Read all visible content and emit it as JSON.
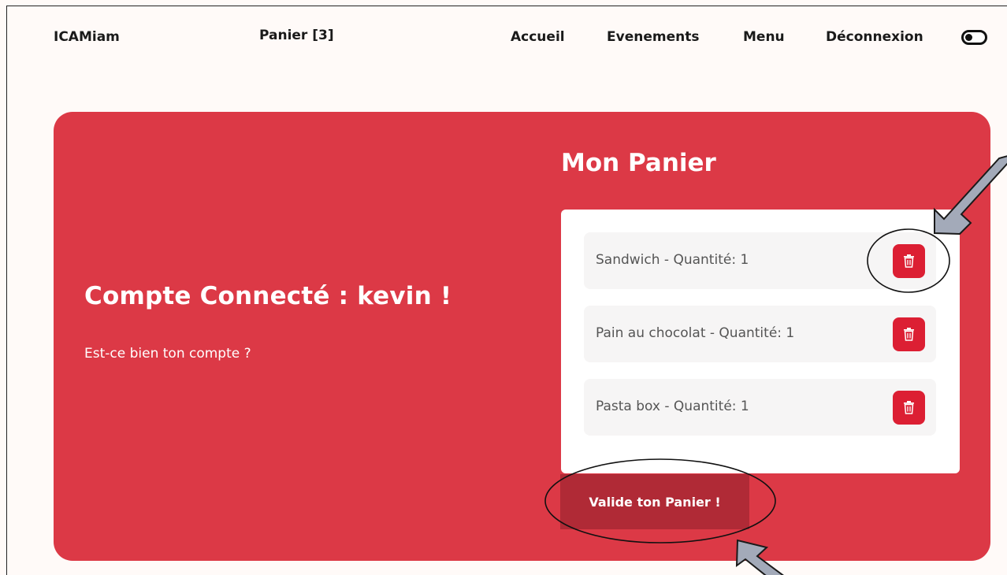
{
  "header": {
    "brand": "ICAMiam",
    "cart_label": "Panier [3]",
    "nav": {
      "accueil": "Accueil",
      "evenements": "Evenements",
      "menu": "Menu",
      "deconnexion": "Déconnexion"
    }
  },
  "account": {
    "title": "Compte Connecté : kevin !",
    "question": "Est-ce bien ton compte ?"
  },
  "cart": {
    "title": "Mon Panier",
    "items": [
      {
        "label": "Sandwich - Quantité: 1"
      },
      {
        "label": "Pain au chocolat - Quantité: 1"
      },
      {
        "label": "Pasta box - Quantité: 1"
      }
    ],
    "validate_label": "Valide ton Panier !"
  },
  "colors": {
    "accent": "#dc3946",
    "button": "#dc1f33",
    "validate": "#b02a36",
    "background": "#fffaf8",
    "annotation_arrow": "#a3aab9"
  },
  "icons": [
    "trash-icon",
    "theme-toggle-icon",
    "annotation-arrow-icon"
  ]
}
